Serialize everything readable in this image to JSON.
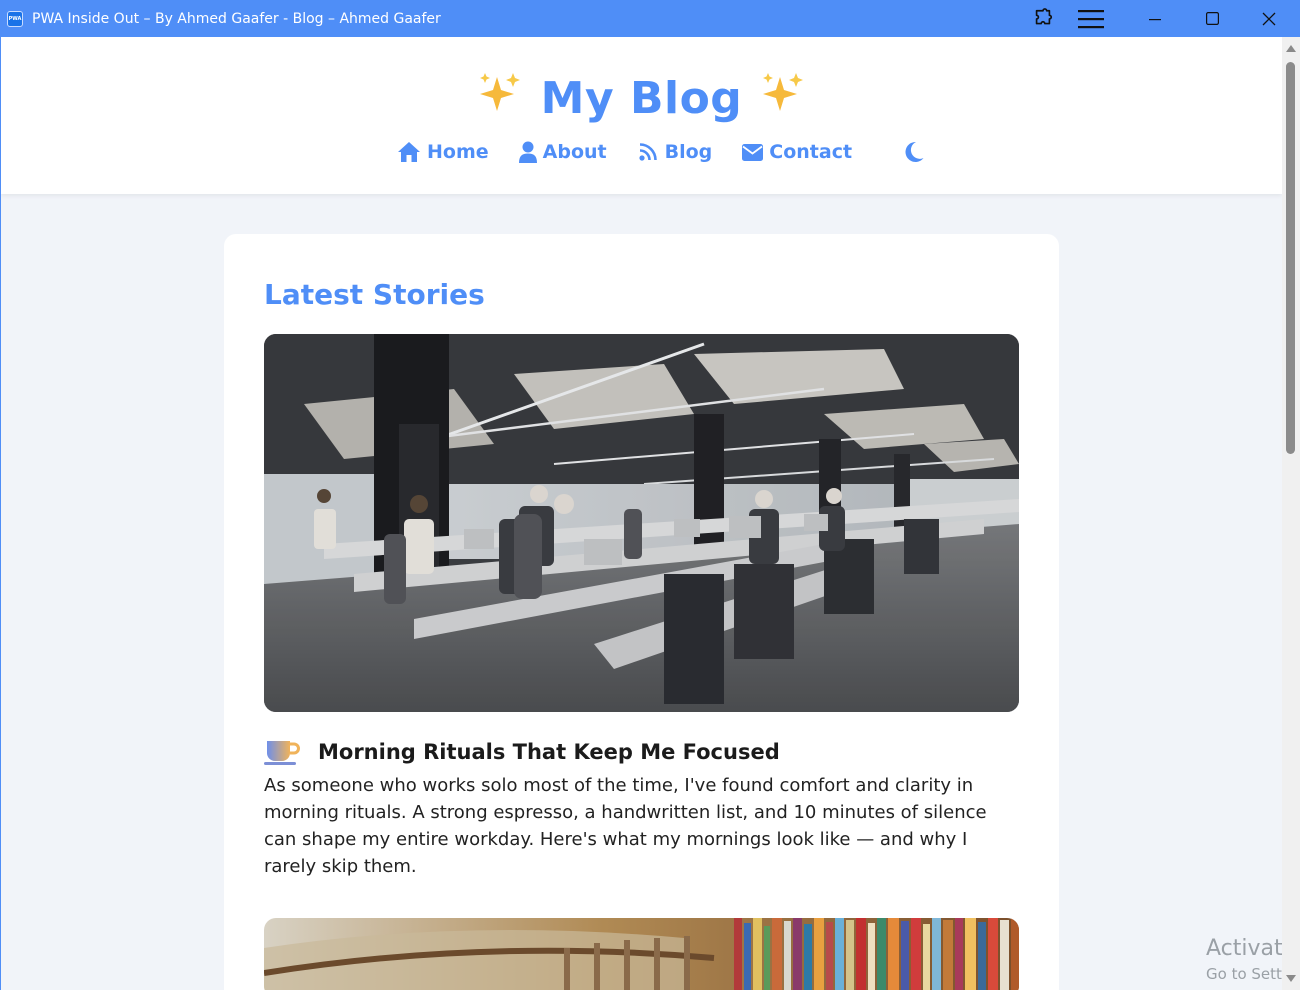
{
  "window": {
    "title": "PWA Inside Out – By Ahmed Gaafer - Blog – Ahmed Gaafer",
    "app_icon_text": "PWA",
    "controls": [
      "extensions-icon",
      "menu-icon",
      "minimize-icon",
      "maximize-icon",
      "close-icon"
    ]
  },
  "header": {
    "site_title": "My Blog",
    "nav": [
      {
        "label": "Home",
        "icon": "home-icon"
      },
      {
        "label": "About",
        "icon": "user-icon"
      },
      {
        "label": "Blog",
        "icon": "rss-icon"
      },
      {
        "label": "Contact",
        "icon": "envelope-icon"
      }
    ],
    "theme_toggle_icon": "moon-icon"
  },
  "main": {
    "section_title": "Latest Stories",
    "posts": [
      {
        "image": "open office with people working at laptops",
        "emoji": "coffee-cup-icon",
        "title": "Morning Rituals That Keep Me Focused",
        "body": "As someone who works solo most of the time, I've found comfort and clarity in morning rituals. A strong espresso, a handwritten list, and 10 minutes of silence can shape my entire workday. Here's what my mornings look like — and why I rarely skip them."
      },
      {
        "image": "library bookshelves"
      }
    ]
  },
  "watermark": {
    "line1": "Activate",
    "line2": "Go to Settin"
  },
  "colors": {
    "accent": "#4f8ef7",
    "background": "#f1f4f9",
    "card": "#ffffff",
    "text": "#222222"
  }
}
